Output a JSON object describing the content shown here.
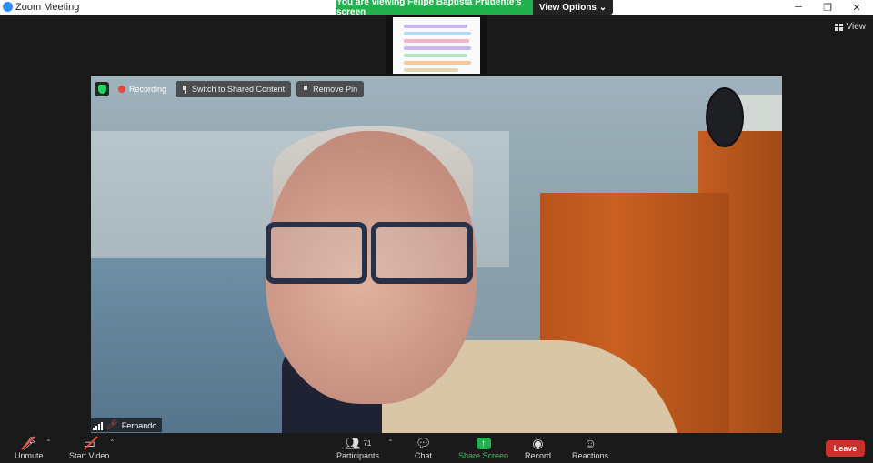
{
  "window": {
    "title": "Zoom Meeting"
  },
  "banner": {
    "text": "You are viewing Felipe Baptista Prudente’s screen",
    "view_options": "View Options"
  },
  "view_button": {
    "label": "View"
  },
  "video_controls": {
    "recording": "Recording",
    "switch_shared": "Switch to Shared Content",
    "remove_pin": "Remove Pin"
  },
  "participant": {
    "name": "Fernando"
  },
  "toolbar": {
    "unmute": "Unmute",
    "start_video": "Start Video",
    "participants": "Participants",
    "participants_count": "71",
    "chat": "Chat",
    "share_screen": "Share Screen",
    "record": "Record",
    "reactions": "Reactions",
    "leave": "Leave"
  },
  "colors": {
    "share_green": "#23b04e",
    "leave_red": "#c8322c",
    "banner_green": "#23b04e"
  }
}
